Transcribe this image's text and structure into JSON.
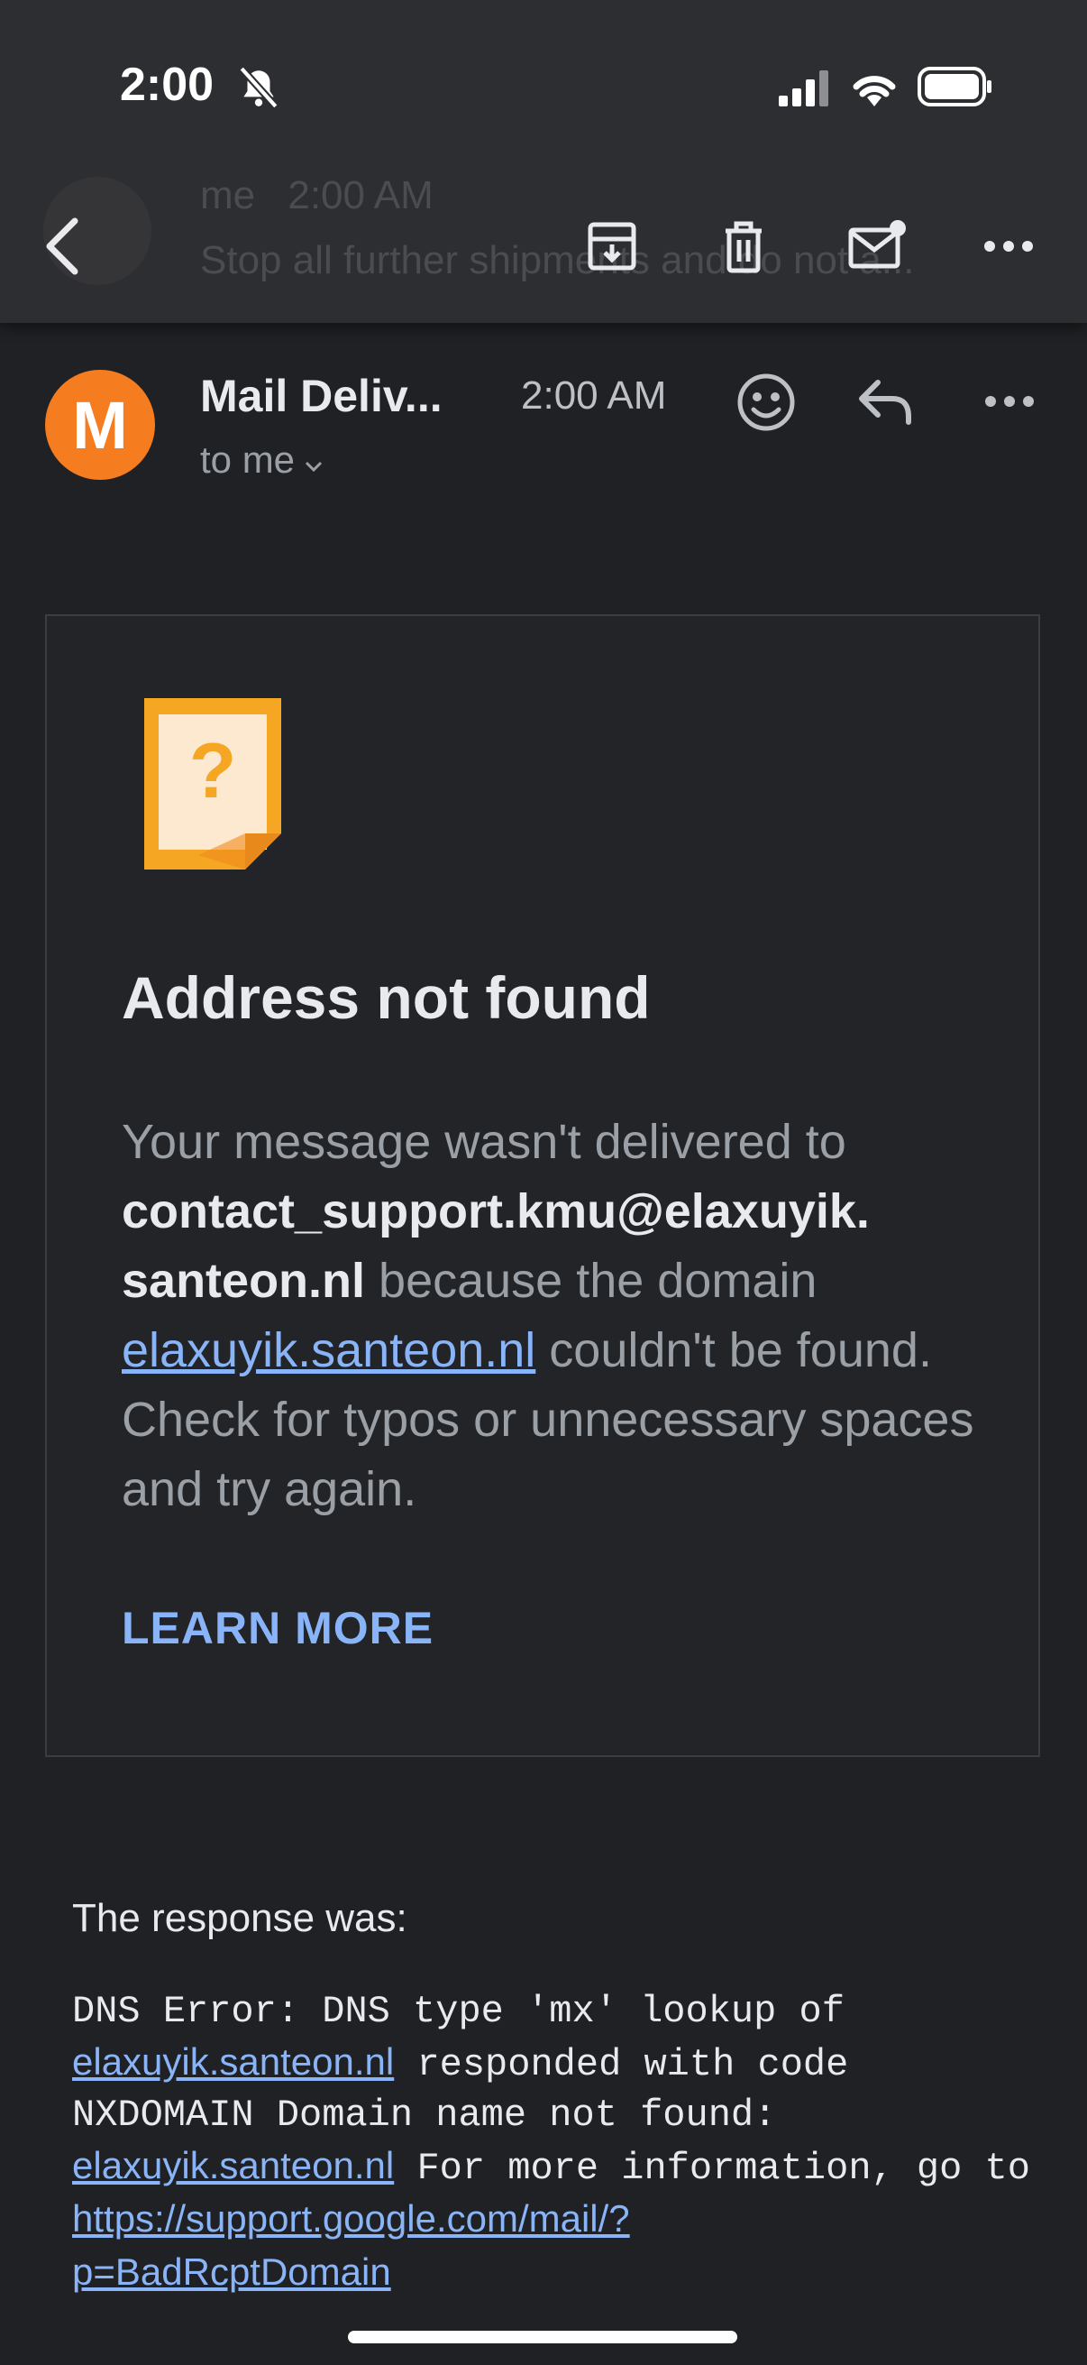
{
  "status_bar": {
    "time": "2:00"
  },
  "background_thread": {
    "sender_fragment": "me",
    "time_fragment": "2:00 AM",
    "snippet_fragment": "Stop all further shipments and do not a..."
  },
  "message": {
    "sender_initial": "M",
    "sender_name": "Mail Deliv...",
    "time": "2:00 AM",
    "recipient_label": "to me"
  },
  "card": {
    "headline": "Address not found",
    "body_intro": "Your message wasn't delivered to ",
    "email_line1": "contact_support.kmu@elaxuyik.",
    "email_line2": "santeon.nl",
    "body_mid": " because the domain ",
    "domain_link": "elaxuyik.santeon.nl",
    "body_end": " couldn't be found. Check for typos or unnecessary spaces and try again.",
    "learn_more": "LEARN MORE"
  },
  "response": {
    "label": "The response was:",
    "p1": "DNS Error: DNS type 'mx' lookup of ",
    "link1": "elaxuyik.santeon.nl",
    "p2": " responded with code NXDOMAIN Domain name not found: ",
    "link2": "elaxuyik.santeon.nl",
    "p3": " For more information, go to ",
    "link3_line1": "https://support.google.com/mail/?",
    "link3_line2": "p=BadRcptDomain"
  },
  "colors": {
    "background": "#202124",
    "toolbar": "#2d2e31",
    "avatar": "#f57c1f",
    "link": "#8ab4f8"
  }
}
